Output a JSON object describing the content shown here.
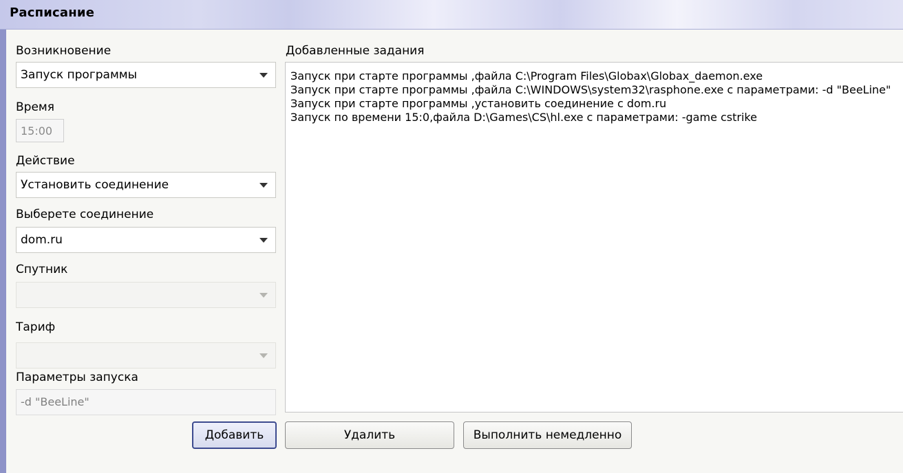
{
  "window": {
    "title": "Расписание"
  },
  "form": {
    "occurrence": {
      "label": "Возникновение",
      "value": "Запуск программы"
    },
    "time": {
      "label": "Время",
      "value": "15:00"
    },
    "action": {
      "label": "Действие",
      "value": "Установить соединение"
    },
    "connection": {
      "label": "Выберете соединение",
      "value": "dom.ru"
    },
    "satellite": {
      "label": "Спутник",
      "value": ""
    },
    "tariff": {
      "label": "Тариф",
      "value": ""
    },
    "launch_params": {
      "label": "Параметры запуска",
      "value": "-d \"BeeLine\""
    }
  },
  "tasks": {
    "label": "Добавленные задания",
    "items": [
      "Запуск при старте программы ,файла C:\\Program Files\\Globax\\Globax_daemon.exe",
      "Запуск при старте программы ,файла C:\\WINDOWS\\system32\\rasphone.exe с параметрами: -d \"BeeLine\"",
      "Запуск при старте программы ,установить соединение с dom.ru",
      "Запуск по времени 15:0,файла D:\\Games\\CS\\hl.exe с параметрами: -game cstrike"
    ]
  },
  "buttons": {
    "add": "Добавить",
    "delete": "Удалить",
    "run_now": "Выполнить немедленно"
  },
  "icons": {
    "dropdown": "chevron-down-icon"
  },
  "colors": {
    "accent": "#3c4a8f",
    "header": "#d8daf1"
  }
}
